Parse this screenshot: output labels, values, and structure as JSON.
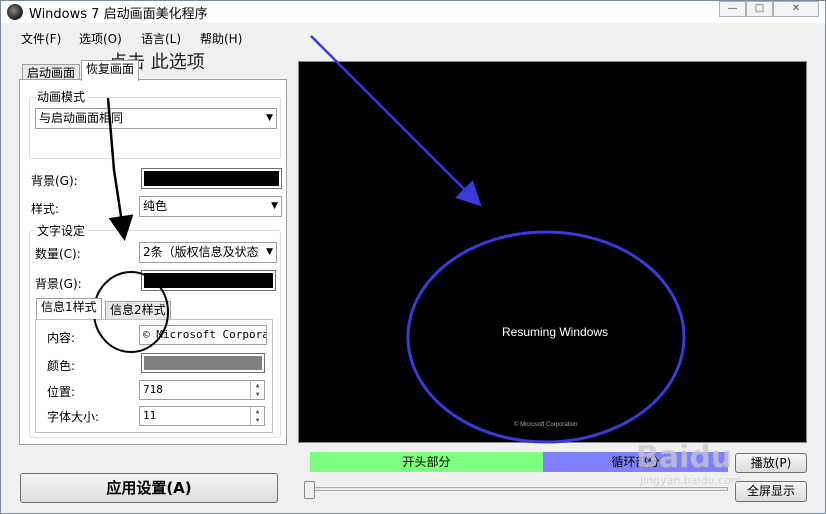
{
  "window": {
    "title": "Windows 7 启动画面美化程序",
    "minimize_glyph": "—",
    "maximize_glyph": "□",
    "close_glyph": "✕"
  },
  "menu": {
    "items": [
      "文件(F)",
      "选项(O)",
      "语言(L)",
      "帮助(H)"
    ]
  },
  "tabs": {
    "main": [
      "启动画面",
      "恢复画面"
    ],
    "active_main": 1,
    "info": [
      "信息1样式",
      "信息2样式"
    ]
  },
  "animation": {
    "group_label": "动画模式",
    "mode_value": "与启动画面相同"
  },
  "background": {
    "label": "背景(G):",
    "color": "#000000"
  },
  "style": {
    "label": "样式:",
    "value": "纯色"
  },
  "text_settings": {
    "group_label": "文字设定",
    "count_label": "数量(C):",
    "count_value": "2条（版权信息及状态",
    "bg_label": "背景(G):",
    "bg_color": "#000000"
  },
  "info_fields": {
    "content_label": "内容:",
    "content_value": "© Microsoft Corporat:",
    "color_label": "颜色:",
    "color_value": "#808080",
    "position_label": "位置:",
    "position_value": "718",
    "font_size_label": "字体大小:",
    "font_size_value": "11"
  },
  "preview": {
    "status_text": "Resuming Windows",
    "copyright_text": "© Microsoft Corporation",
    "background": "#000000"
  },
  "timeline": {
    "segments": [
      {
        "label": "开头部分",
        "color": "#7fff7f"
      },
      {
        "label": "循环部分",
        "color": "#8080ff"
      }
    ]
  },
  "buttons": {
    "apply": "应用设置(A)",
    "play": "播放(P)",
    "fullscreen": "全屏显示"
  },
  "annotations": {
    "click_hint": "点击  此选项",
    "colors": {
      "arrow_black": "#000000",
      "arrow_blue": "#3a3ad8",
      "circle_blue": "#3a3ad8"
    }
  },
  "watermark": {
    "text": "Baidu",
    "sub": "jingyan.baidu.com"
  }
}
